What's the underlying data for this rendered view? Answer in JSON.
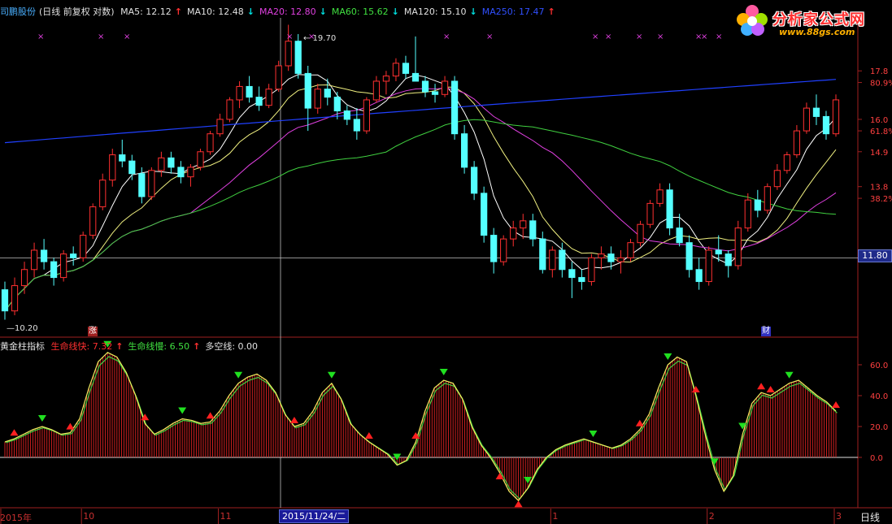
{
  "legend": {
    "stock_name": "司鹏股份",
    "chart_mode": "(日线 前复权 对数)",
    "ma": [
      {
        "label": "MA5: 12.12",
        "color": "#e0e0e0",
        "arrow": "↑",
        "arrow_color": "#ff3030"
      },
      {
        "label": "MA10: 12.48",
        "color": "#e0e0e0",
        "arrow": "↓",
        "arrow_color": "#00e0e0"
      },
      {
        "label": "MA20: 12.80",
        "color": "#e040e0",
        "arrow": "↓",
        "arrow_color": "#00e0e0"
      },
      {
        "label": "MA60: 15.62",
        "color": "#40e040",
        "arrow": "↓",
        "arrow_color": "#00e0e0"
      },
      {
        "label": "MA120: 15.10",
        "color": "#e0e0e0",
        "arrow": "↓",
        "arrow_color": "#00e0e0"
      },
      {
        "label": "MA250: 17.47",
        "color": "#3050ff",
        "arrow": "↑",
        "arrow_color": "#ff3030"
      }
    ]
  },
  "sub_legend": {
    "name": "黄金柱指标",
    "items": [
      {
        "label": "生命线快: 7.32",
        "color": "#ff3030",
        "arrow": "↑",
        "arrow_color": "#ff3030"
      },
      {
        "label": "生命线慢: 6.50",
        "color": "#40e040",
        "arrow": "↑",
        "arrow_color": "#ff3030"
      },
      {
        "label": "多空线: 0.00",
        "color": "#e0e0e0",
        "arrow": "",
        "arrow_color": "#e0e0e0"
      }
    ]
  },
  "brand": {
    "title": "分析家公式网",
    "url": "www.88gs.com"
  },
  "annotations": {
    "high": "19.70",
    "low": "10.20",
    "current_price": "11.80",
    "badge_zhang": "涨",
    "badge_cai": "财"
  },
  "axis": {
    "price_ticks": [
      {
        "label": "17.8",
        "y": 17.8,
        "color": "#ff4040"
      },
      {
        "label": "80.9%",
        "y": 17.35,
        "color": "#ff4040"
      },
      {
        "label": "16.0",
        "y": 16.0,
        "color": "#ff4040"
      },
      {
        "label": "61.8%",
        "y": 15.6,
        "color": "#ff4040"
      },
      {
        "label": "14.9",
        "y": 14.9,
        "color": "#ff4040"
      },
      {
        "label": "13.8",
        "y": 13.8,
        "color": "#ff4040"
      },
      {
        "label": "38.2%",
        "y": 13.45,
        "color": "#ff4040"
      }
    ],
    "osc_ticks": [
      "60.0",
      "40.0",
      "20.0",
      "0.0"
    ],
    "x_labels": [
      {
        "label": "2015年",
        "index": 0
      },
      {
        "label": "10",
        "index": 8
      },
      {
        "label": "11",
        "index": 22
      },
      {
        "label": "1",
        "index": 56
      },
      {
        "label": "2",
        "index": 72
      },
      {
        "label": "3",
        "index": 85
      }
    ],
    "date_cursor": "2015/11/24/二",
    "period": "日线"
  },
  "colors": {
    "up": "#ff3030",
    "down": "#54ffff",
    "ma5": "#ffffff",
    "ma10": "#f0f080",
    "ma20": "#e040e0",
    "ma60": "#40d040",
    "ma250": "#2040ff"
  },
  "chart_data": [
    {
      "type": "candlestick",
      "title": "",
      "ylim": [
        10.0,
        20.0
      ],
      "ohlc": [
        [
          11.0,
          11.2,
          10.3,
          10.5
        ],
        [
          10.5,
          11.3,
          10.4,
          11.1
        ],
        [
          11.1,
          11.7,
          10.9,
          11.5
        ],
        [
          11.5,
          12.2,
          11.3,
          12.0
        ],
        [
          12.0,
          12.3,
          11.5,
          11.7
        ],
        [
          11.7,
          11.8,
          11.1,
          11.3
        ],
        [
          11.3,
          12.0,
          11.2,
          11.9
        ],
        [
          11.9,
          12.1,
          11.6,
          11.8
        ],
        [
          11.8,
          12.5,
          11.7,
          12.4
        ],
        [
          12.4,
          13.3,
          12.3,
          13.2
        ],
        [
          13.2,
          14.2,
          13.1,
          14.0
        ],
        [
          14.0,
          15.0,
          13.8,
          14.8
        ],
        [
          14.8,
          15.3,
          14.4,
          14.6
        ],
        [
          14.6,
          14.8,
          14.0,
          14.2
        ],
        [
          14.2,
          14.4,
          13.3,
          13.5
        ],
        [
          13.5,
          14.4,
          13.4,
          14.3
        ],
        [
          14.3,
          14.9,
          14.1,
          14.7
        ],
        [
          14.7,
          14.9,
          14.2,
          14.4
        ],
        [
          14.4,
          14.6,
          13.9,
          14.1
        ],
        [
          14.1,
          14.5,
          13.8,
          14.4
        ],
        [
          14.4,
          15.0,
          14.3,
          14.9
        ],
        [
          14.9,
          15.6,
          14.8,
          15.5
        ],
        [
          15.5,
          16.2,
          15.4,
          16.0
        ],
        [
          16.0,
          16.8,
          15.9,
          16.7
        ],
        [
          16.7,
          17.4,
          16.4,
          17.2
        ],
        [
          17.2,
          17.6,
          16.6,
          16.8
        ],
        [
          16.8,
          17.2,
          16.3,
          16.5
        ],
        [
          16.5,
          17.3,
          16.4,
          17.1
        ],
        [
          17.1,
          18.2,
          17.0,
          18.0
        ],
        [
          18.0,
          19.7,
          17.8,
          19.0
        ],
        [
          19.0,
          19.3,
          17.5,
          17.7
        ],
        [
          17.7,
          18.0,
          15.6,
          16.4
        ],
        [
          16.4,
          17.3,
          16.2,
          17.1
        ],
        [
          17.1,
          17.5,
          16.5,
          16.8
        ],
        [
          16.8,
          17.0,
          16.0,
          16.3
        ],
        [
          16.3,
          16.5,
          15.8,
          16.0
        ],
        [
          16.0,
          16.4,
          15.3,
          15.6
        ],
        [
          15.6,
          16.8,
          15.5,
          16.7
        ],
        [
          16.7,
          17.6,
          16.6,
          17.4
        ],
        [
          17.4,
          17.8,
          16.9,
          17.6
        ],
        [
          17.6,
          18.3,
          17.4,
          18.1
        ],
        [
          18.1,
          18.4,
          17.5,
          17.7
        ],
        [
          17.7,
          19.2,
          17.6,
          17.4
        ],
        [
          17.4,
          17.6,
          16.8,
          17.0
        ],
        [
          17.0,
          17.3,
          16.6,
          16.9
        ],
        [
          16.9,
          17.6,
          16.8,
          17.4
        ],
        [
          17.4,
          17.6,
          15.3,
          15.5
        ],
        [
          15.5,
          15.8,
          14.2,
          14.4
        ],
        [
          14.4,
          14.6,
          13.4,
          13.6
        ],
        [
          13.6,
          13.8,
          12.2,
          12.4
        ],
        [
          12.4,
          12.6,
          11.4,
          11.7
        ],
        [
          11.7,
          12.4,
          11.6,
          12.3
        ],
        [
          12.3,
          12.8,
          12.1,
          12.6
        ],
        [
          12.6,
          13.0,
          12.3,
          12.8
        ],
        [
          12.8,
          13.0,
          12.1,
          12.3
        ],
        [
          12.3,
          12.5,
          11.4,
          11.5
        ],
        [
          11.5,
          12.1,
          11.3,
          12.0
        ],
        [
          12.0,
          12.2,
          11.3,
          11.5
        ],
        [
          11.5,
          11.7,
          10.8,
          11.3
        ],
        [
          11.3,
          11.5,
          11.0,
          11.2
        ],
        [
          11.2,
          11.9,
          11.1,
          11.8
        ],
        [
          11.8,
          12.1,
          11.5,
          11.9
        ],
        [
          11.9,
          12.1,
          11.5,
          11.7
        ],
        [
          11.7,
          12.0,
          11.4,
          11.8
        ],
        [
          11.8,
          12.3,
          11.7,
          12.2
        ],
        [
          12.2,
          12.8,
          12.1,
          12.7
        ],
        [
          12.7,
          13.4,
          12.6,
          13.3
        ],
        [
          13.3,
          13.9,
          13.2,
          13.7
        ],
        [
          13.7,
          13.9,
          12.4,
          12.6
        ],
        [
          12.6,
          13.0,
          12.1,
          12.2
        ],
        [
          12.2,
          12.4,
          11.3,
          11.5
        ],
        [
          11.5,
          11.8,
          11.0,
          11.2
        ],
        [
          11.2,
          12.1,
          11.1,
          12.0
        ],
        [
          12.0,
          12.4,
          11.7,
          11.9
        ],
        [
          11.9,
          12.0,
          11.3,
          11.6
        ],
        [
          11.6,
          12.8,
          11.5,
          12.6
        ],
        [
          12.6,
          13.6,
          12.5,
          13.4
        ],
        [
          13.4,
          13.7,
          12.9,
          13.1
        ],
        [
          13.1,
          13.9,
          13.0,
          13.8
        ],
        [
          13.8,
          14.5,
          13.7,
          14.3
        ],
        [
          14.3,
          14.9,
          14.2,
          14.8
        ],
        [
          14.8,
          15.8,
          14.7,
          15.6
        ],
        [
          15.6,
          16.6,
          15.5,
          16.4
        ],
        [
          16.4,
          16.9,
          15.8,
          16.1
        ],
        [
          16.1,
          16.3,
          15.3,
          15.5
        ],
        [
          15.5,
          16.9,
          15.4,
          16.7
        ]
      ]
    },
    {
      "type": "bar",
      "title": "",
      "ylim": [
        -30,
        70
      ],
      "values": [
        10,
        12,
        15,
        18,
        20,
        18,
        15,
        16,
        25,
        45,
        62,
        68,
        65,
        55,
        40,
        22,
        15,
        18,
        22,
        25,
        24,
        22,
        23,
        30,
        40,
        48,
        52,
        54,
        50,
        42,
        28,
        20,
        22,
        30,
        42,
        48,
        38,
        22,
        15,
        10,
        6,
        2,
        -5,
        -2,
        10,
        30,
        45,
        50,
        48,
        38,
        20,
        8,
        0,
        -10,
        -22,
        -28,
        -20,
        -8,
        0,
        5,
        8,
        10,
        12,
        10,
        8,
        6,
        8,
        12,
        18,
        28,
        45,
        60,
        65,
        62,
        40,
        15,
        -8,
        -22,
        -12,
        15,
        35,
        42,
        40,
        44,
        48,
        50,
        45,
        40,
        36,
        30
      ],
      "triangles": [
        {
          "index": 1,
          "dir": "up"
        },
        {
          "index": 4,
          "dir": "down"
        },
        {
          "index": 7,
          "dir": "up"
        },
        {
          "index": 11,
          "dir": "down"
        },
        {
          "index": 15,
          "dir": "up"
        },
        {
          "index": 19,
          "dir": "down"
        },
        {
          "index": 22,
          "dir": "up"
        },
        {
          "index": 25,
          "dir": "down"
        },
        {
          "index": 31,
          "dir": "up"
        },
        {
          "index": 35,
          "dir": "down"
        },
        {
          "index": 39,
          "dir": "up"
        },
        {
          "index": 42,
          "dir": "down"
        },
        {
          "index": 44,
          "dir": "up"
        },
        {
          "index": 47,
          "dir": "down"
        },
        {
          "index": 53,
          "dir": "up"
        },
        {
          "index": 55,
          "dir": "up"
        },
        {
          "index": 56,
          "dir": "down"
        },
        {
          "index": 63,
          "dir": "down"
        },
        {
          "index": 68,
          "dir": "up"
        },
        {
          "index": 71,
          "dir": "down"
        },
        {
          "index": 74,
          "dir": "up"
        },
        {
          "index": 76,
          "dir": "down"
        },
        {
          "index": 79,
          "dir": "down"
        },
        {
          "index": 81,
          "dir": "up"
        },
        {
          "index": 82,
          "dir": "up"
        },
        {
          "index": 84,
          "dir": "down"
        },
        {
          "index": 89,
          "dir": "up"
        }
      ]
    }
  ]
}
